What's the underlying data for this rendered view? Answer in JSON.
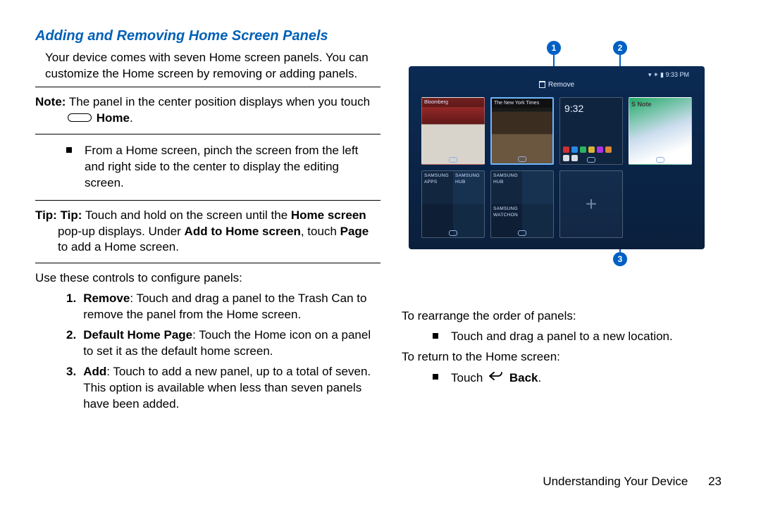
{
  "heading": "Adding and Removing Home Screen Panels",
  "intro": "Your device comes with seven Home screen panels. You can customize the Home screen by removing or adding panels.",
  "note": {
    "label": "Note:",
    "text_before_icon": "The panel in the center position displays when you touch",
    "home_label": "Home"
  },
  "pinch_bullet": "From a Home screen, pinch the screen from the left and right side to the center to display the editing screen.",
  "tip": {
    "label": "Tip: Tip:",
    "line1_before": "Touch and hold on the screen until the ",
    "line1_bold": "Home screen",
    "line2_before": "pop-up displays. Under ",
    "line2_bold1": "Add to Home screen",
    "line2_mid": ", touch ",
    "line2_bold2": "Page",
    "line2_after": " to add a Home screen."
  },
  "controls_lead": "Use these controls to configure panels:",
  "controls": [
    {
      "num": "1.",
      "bold": "Remove",
      "text": ": Touch and drag a panel to the Trash Can to remove the panel from the Home screen."
    },
    {
      "num": "2.",
      "bold": "Default Home Page",
      "text": ": Touch the Home icon on a panel to set it as the default home screen."
    },
    {
      "num": "3.",
      "bold": "Add",
      "text": ": Touch to add a new panel, up to a total of seven. This option is available when less than seven panels have been added."
    }
  ],
  "callouts": {
    "c1": "1",
    "c2": "2",
    "c3": "3"
  },
  "tablet": {
    "status_time": "9:33 PM",
    "remove_label": "Remove",
    "clock_time": "9:32",
    "snote_label": "S Note",
    "tiles": {
      "apps": "SAMSUNG APPS",
      "hub": "SAMSUNG HUB",
      "watchon": "SAMSUNG WATCHON"
    },
    "add_symbol": "+"
  },
  "right": {
    "rearrange_lead": "To rearrange the order of panels:",
    "rearrange_bullet": "Touch and drag a panel to a new location.",
    "return_lead": "To return to the Home screen:",
    "back_prefix": "Touch",
    "back_label": "Back"
  },
  "footer": {
    "section": "Understanding Your Device",
    "page": "23"
  }
}
